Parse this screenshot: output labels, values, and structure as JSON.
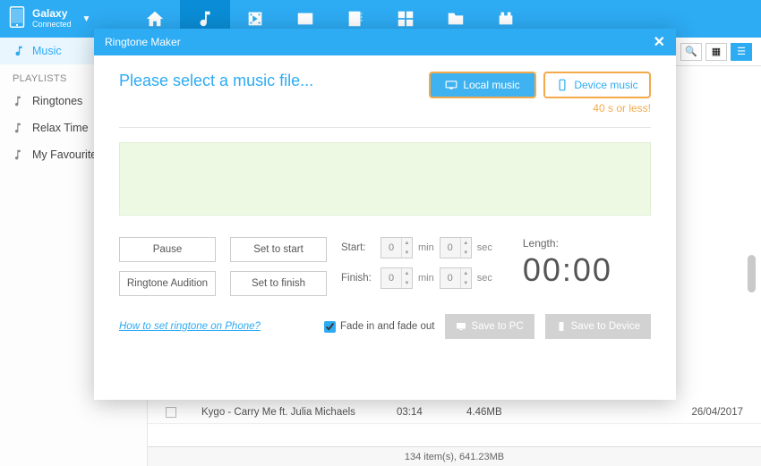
{
  "device": {
    "name": "Galaxy",
    "status": "Connected"
  },
  "nav": [
    "home",
    "music",
    "video",
    "photo",
    "contacts",
    "apps",
    "files",
    "tools"
  ],
  "sidebar": {
    "music_label": "Music",
    "playlists_heading": "PLAYLISTS",
    "items": [
      {
        "label": "Ringtones"
      },
      {
        "label": "Relax Time"
      },
      {
        "label": "My Favourite"
      }
    ]
  },
  "track": {
    "name": "Kygo - Carry Me ft. Julia Michaels",
    "duration": "03:14",
    "size": "4.46MB",
    "date": "26/04/2017"
  },
  "statusbar": "134 item(s), 641.23MB",
  "modal": {
    "title": "Ringtone Maker",
    "prompt": "Please select a music file...",
    "local_btn": "Local music",
    "device_btn": "Device music",
    "limit": "40 s or less!",
    "controls": {
      "pause": "Pause",
      "set_start": "Set to start",
      "audition": "Ringtone Audition",
      "set_finish": "Set to finish",
      "start_label": "Start:",
      "finish_label": "Finish:",
      "min_unit": "min",
      "sec_unit": "sec",
      "start_min": "0",
      "start_sec": "0",
      "finish_min": "0",
      "finish_sec": "0"
    },
    "length_label": "Length:",
    "length_value": "00:00",
    "help_link": "How to set ringtone on Phone?",
    "fade_label": "Fade in and fade out",
    "save_pc": "Save to PC",
    "save_device": "Save to Device"
  }
}
